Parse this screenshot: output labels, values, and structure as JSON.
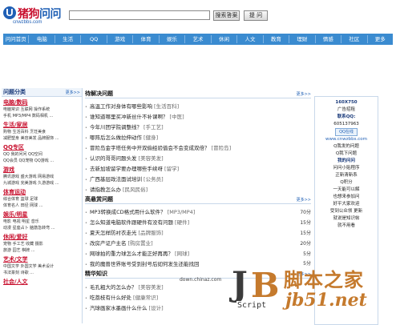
{
  "header": {
    "logo_u": "U",
    "logo_t1": "猪狗",
    "logo_t2": "问问",
    "logo_domain": "cnwzbbs.com",
    "search_placeholder": "",
    "search_button": "搜索答案",
    "ask_button": "提 问"
  },
  "nav": [
    "问问首页",
    "电脑",
    "生活",
    "QQ",
    "游戏",
    "体育",
    "娱乐",
    "艺术",
    "休闲",
    "人文",
    "教育",
    "理财",
    "情感",
    "社区",
    "更多"
  ],
  "left": {
    "title": "问题分类",
    "more": "更多>>",
    "categories": [
      {
        "name": "电脑/数码",
        "sub": [
          "电脑常识 互联网 操作系统",
          "手机 MP3/MP4 数码相机 ..."
        ]
      },
      {
        "name": "生活/家居",
        "sub": [
          "购物 生活百科 烹饪美食",
          "减肥塑身 美容美发 品牌服饰 ..."
        ]
      },
      {
        "name": "QQ专区",
        "sub": [
          "QQ 我的问问 QQ空间",
          "QQ会员 QQ宠物 QQ游戏 ..."
        ]
      },
      {
        "name": "游戏",
        "sub": [
          "腾讯游戏 盛大游戏 网易游戏",
          "九城游戏 完美游戏 久游游戏 ..."
        ]
      },
      {
        "name": "体育运动",
        "sub": [
          "综合体育 篮球 足球",
          "体育名人 田径 网球 ..."
        ]
      },
      {
        "name": "娱乐/明星",
        "sub": [
          "电影 电视 明星 音乐",
          "动漫 星座占卜 脑筋急转弯 ..."
        ]
      },
      {
        "name": "休闲/爱好",
        "sub": [
          "宠物 手工艺 收藏 摄影",
          "旅游 园艺 棋牌 ..."
        ]
      },
      {
        "name": "艺术/文学",
        "sub": [
          "中国文学 外国文学 美术设计",
          "书法篆刻 诗歌 ..."
        ]
      },
      {
        "name": "社会/人文",
        "sub": []
      }
    ]
  },
  "mid": {
    "pending_title": "待解决问题",
    "pending_more": "更多>>",
    "pending": [
      {
        "text": "高温工作对身体有哪些影响",
        "tag": "[生活百科]"
      },
      {
        "text": "谁知道哪里买冲新丝什不补课啊？",
        "tag": "[中医]"
      },
      {
        "text": "今年川团学院调整线？",
        "tag": "[手工艺]"
      },
      {
        "text": "哪阵后怎么做拉伸动作",
        "tag": "[健身]"
      },
      {
        "text": "冒险岛金字塔任务中开双偷经验值会不会变成双倍？",
        "tag": "[冒险岛]"
      },
      {
        "text": "认识的哥哥问题头发",
        "tag": "[美容美发]"
      },
      {
        "text": "去新加坡留学要办理哪些手续呀",
        "tag": "[留学]"
      },
      {
        "text": "广西基层政法面试培训",
        "tag": "[公务员]"
      },
      {
        "text": "请指教怎么办",
        "tag": "[民风民俗]"
      }
    ],
    "reward_title": "高悬赏问题",
    "reward_more": "更多>>",
    "reward": [
      {
        "text": "MP3转换成CD格式用什么软件？",
        "tag": "[MP3/MP4]",
        "score": "70分"
      },
      {
        "text": "怎么知道电脑软件跟硬件有没有问题",
        "tag": "[硬件]",
        "score": "15分"
      },
      {
        "text": "夏天怎样防衬衣走光",
        "tag": "[品牌服饰]",
        "score": "15分"
      },
      {
        "text": "改房产证户主名",
        "tag": "[购房置业]",
        "score": "20分"
      },
      {
        "text": "网球拍的重力球怎么才能正好再再？",
        "tag": "[网球]",
        "score": "5分"
      },
      {
        "text": "我的魔兽世界账号受到封号后如何发生还能找回",
        "tag": "",
        "score": "5分"
      }
    ],
    "good_title": "精华知识",
    "good_more": "更多>>",
    "good": [
      {
        "text": "毛孔粗大的怎么办？",
        "tag": "[美容美发]"
      },
      {
        "text": "吃荔枝有什么好处",
        "tag": "[健康常识]"
      },
      {
        "text": "汽球画家水墨画什么什么",
        "tag": "[设计]"
      }
    ]
  },
  "right": {
    "lines": [
      {
        "t": "160X750",
        "cls": "bold"
      },
      {
        "t": "广告招租",
        "cls": ""
      },
      {
        "t": "联系QQ:",
        "cls": "bold"
      },
      {
        "t": "605137963",
        "cls": ""
      },
      {
        "t": "",
        "cls": "badge"
      },
      {
        "t": "www.cnwzbbs.com",
        "cls": "blue"
      },
      {
        "t": "Q我发的问题",
        "cls": ""
      },
      {
        "t": "Q我下问题",
        "cls": ""
      },
      {
        "t": "我的问问",
        "cls": "bold"
      },
      {
        "t": "问问小贴程序",
        "cls": ""
      },
      {
        "t": "正新清新系",
        "cls": ""
      },
      {
        "t": "Q积分",
        "cls": ""
      },
      {
        "t": "一天能可以解",
        "cls": ""
      },
      {
        "t": "也想来参加问",
        "cls": ""
      },
      {
        "t": "好平大家欢迎",
        "cls": ""
      },
      {
        "t": "",
        "cls": ""
      },
      {
        "t": "",
        "cls": ""
      },
      {
        "t": "受到公众领 更新",
        "cls": ""
      },
      {
        "t": "就说是知识帖",
        "cls": ""
      },
      {
        "t": "就不用看",
        "cls": ""
      }
    ],
    "qq_badge": "QQ在线"
  },
  "watermark": {
    "jb_j": "J",
    "jb_b": "B",
    "script": "Script",
    "cn": "脚本之家",
    "url": "jb51.net",
    "chinaz": "down.chinaz.com"
  }
}
